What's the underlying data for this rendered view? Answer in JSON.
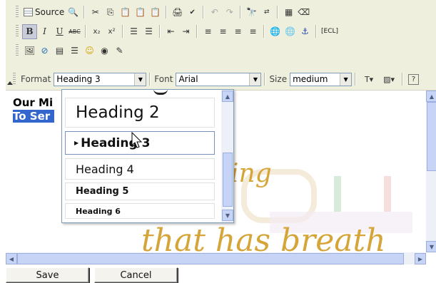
{
  "toolbar": {
    "source_label": "Source",
    "special_label": "[ECL]",
    "format_label": "Format",
    "format_value": "Heading 3",
    "font_label": "Font",
    "font_value": "Arial",
    "size_label": "Size",
    "size_value": "medium",
    "help_label": "?"
  },
  "content": {
    "line1": "Our Mi",
    "line2": "To Ser",
    "decor_word1": "ing",
    "decor_word2": "that has breath"
  },
  "format_dropdown": {
    "options": [
      "Heading 2",
      "Heading 3",
      "Heading 4",
      "Heading 5",
      "Heading 6"
    ],
    "selected": "Heading 3"
  },
  "buttons": {
    "save": "Save",
    "cancel": "Cancel"
  },
  "colors": {
    "toolbar_bg": "#efefde",
    "selection_bg": "#3366cc",
    "scrollbar_thumb": "#c8d4f5",
    "decor_text": "#d6a53a"
  }
}
